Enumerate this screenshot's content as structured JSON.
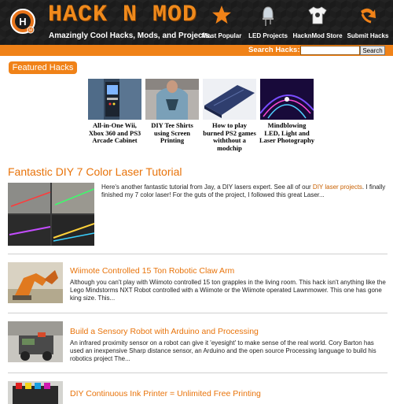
{
  "header": {
    "logo_text": "HACK N MOD",
    "tagline": "Amazingly Cool Hacks, Mods, and Projects.",
    "nav": [
      {
        "label": "Most Popular",
        "icon": "star-icon"
      },
      {
        "label": "LED Projects",
        "icon": "led-icon"
      },
      {
        "label": "HacknMod Store",
        "icon": "tshirt-icon"
      },
      {
        "label": "Submit Hacks",
        "icon": "arrow-icon"
      }
    ]
  },
  "search": {
    "label": "Search Hacks:",
    "value": "",
    "button": "Search"
  },
  "featured": {
    "heading": "Featured Hacks",
    "items": [
      {
        "caption": "All-in-One Wii, Xbox 360 and PS3 Arcade Cabinet"
      },
      {
        "caption": "DIY Tee Shirts using Screen Printing"
      },
      {
        "caption": "How to play burned PS2 games withthout a modchip"
      },
      {
        "caption": "Mindblowing LED, Light and Laser Photography"
      }
    ]
  },
  "main_article": {
    "title": "Fantastic DIY 7 Color Laser Tutorial",
    "text_a": "Here's another fantastic tutorial from Jay, a DIY lasers expert. See all of our ",
    "text_link": "DIY laser projects",
    "text_b": ". I finally finished my 7 color laser! For the guts of the project, I followed this great Laser..."
  },
  "articles": [
    {
      "title": "Wiimote Controlled 15 Ton Robotic Claw Arm",
      "summary": "Although you can't play with Wiimoto controlled 15 ton grapples in the living room. This hack isn't anything like the Lego Mindstorms NXT Robot controlled with a Wiimote or the Wiimote operated Lawnmower. This one has gone king size. This..."
    },
    {
      "title": "Build a Sensory Robot with Arduino and Processing",
      "summary": "An infrared proximity sensor on a robot can give it 'eyesight' to make sense of the real world. Cory Barton has used an inexpensive Sharp distance sensor, an Arduino and the open source Processing language to build his robotics project The..."
    },
    {
      "title": "DIY Continuous Ink Printer = Unlimited Free Printing",
      "summary": ""
    }
  ],
  "colors": {
    "accent": "#f08218",
    "title": "#e8730a",
    "header_bg": "#1b1b1b"
  }
}
